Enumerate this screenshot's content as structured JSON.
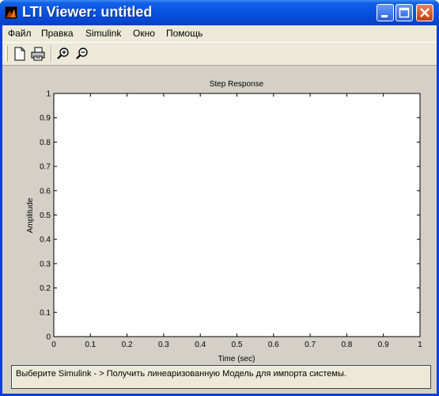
{
  "window": {
    "title": "LTI Viewer: untitled"
  },
  "menu": [
    "Файл",
    "Правка",
    "Simulink",
    "Окно",
    "Помощь"
  ],
  "toolbar": {
    "new": "new-file-icon",
    "print": "print-icon",
    "zoom_in": "zoom-in-icon",
    "zoom_out": "zoom-out-icon"
  },
  "status_text": "Выберите Simulink - > Получить линеаризованную Модель для импорта системы.",
  "chart_data": {
    "type": "line",
    "title": "Step Response",
    "xlabel": "Time (sec)",
    "ylabel": "Amplitude",
    "xlim": [
      0,
      1
    ],
    "ylim": [
      0,
      1
    ],
    "xticks": [
      "0",
      "0.1",
      "0.2",
      "0.3",
      "0.4",
      "0.5",
      "0.6",
      "0.7",
      "0.8",
      "0.9",
      "1"
    ],
    "yticks": [
      "0",
      "0.1",
      "0.2",
      "0.3",
      "0.4",
      "0.5",
      "0.6",
      "0.7",
      "0.8",
      "0.9",
      "1"
    ],
    "grid": false,
    "series": []
  }
}
